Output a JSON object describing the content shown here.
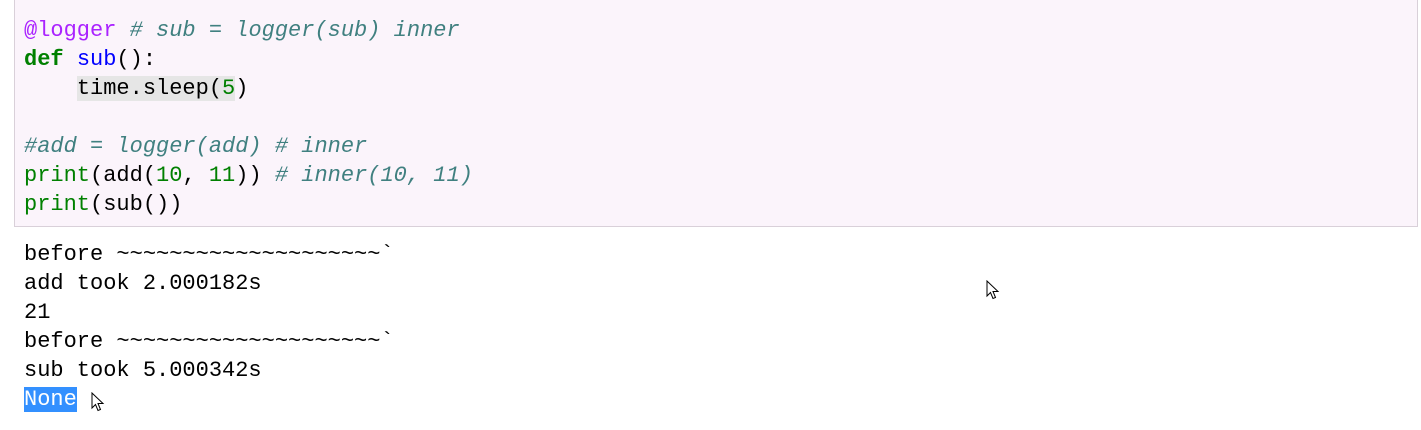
{
  "code_cell": {
    "lines": [
      [
        {
          "t": "@logger",
          "c": "deco"
        },
        {
          "t": " ",
          "c": "plain"
        },
        {
          "t": "# sub = logger(sub) inner",
          "c": "comment"
        }
      ],
      [
        {
          "t": "def",
          "c": "kw"
        },
        {
          "t": " ",
          "c": "plain"
        },
        {
          "t": "sub",
          "c": "fn"
        },
        {
          "t": "():",
          "c": "plain"
        }
      ],
      [
        {
          "t": "    ",
          "c": "plain"
        },
        {
          "t": "time.sleep(",
          "c": "plain",
          "hl": true
        },
        {
          "t": "5",
          "c": "num",
          "hl": true
        },
        {
          "t": ")",
          "c": "plain"
        }
      ],
      [],
      [
        {
          "t": "#add = logger(add) # inner",
          "c": "comment"
        }
      ],
      [
        {
          "t": "print",
          "c": "builtin"
        },
        {
          "t": "(add(",
          "c": "plain"
        },
        {
          "t": "10",
          "c": "num"
        },
        {
          "t": ", ",
          "c": "plain"
        },
        {
          "t": "11",
          "c": "num"
        },
        {
          "t": ")) ",
          "c": "plain"
        },
        {
          "t": "# inner(10, 11)",
          "c": "comment"
        }
      ],
      [
        {
          "t": "print",
          "c": "builtin"
        },
        {
          "t": "(sub())",
          "c": "plain"
        }
      ]
    ]
  },
  "output": {
    "lines": [
      "before ~~~~~~~~~~~~~~~~~~~~`",
      "add took 2.000182s",
      "21",
      "before ~~~~~~~~~~~~~~~~~~~~`",
      "sub took 5.000342s"
    ],
    "selected_text": "None"
  },
  "colors": {
    "cell_background": "#fbf4fb",
    "selection": "#3390ff",
    "comment": "#408080",
    "keyword": "#008000",
    "decorator": "#aa22ff",
    "function": "#0000ff"
  },
  "icons": [
    "mouse-pointer-icon"
  ]
}
